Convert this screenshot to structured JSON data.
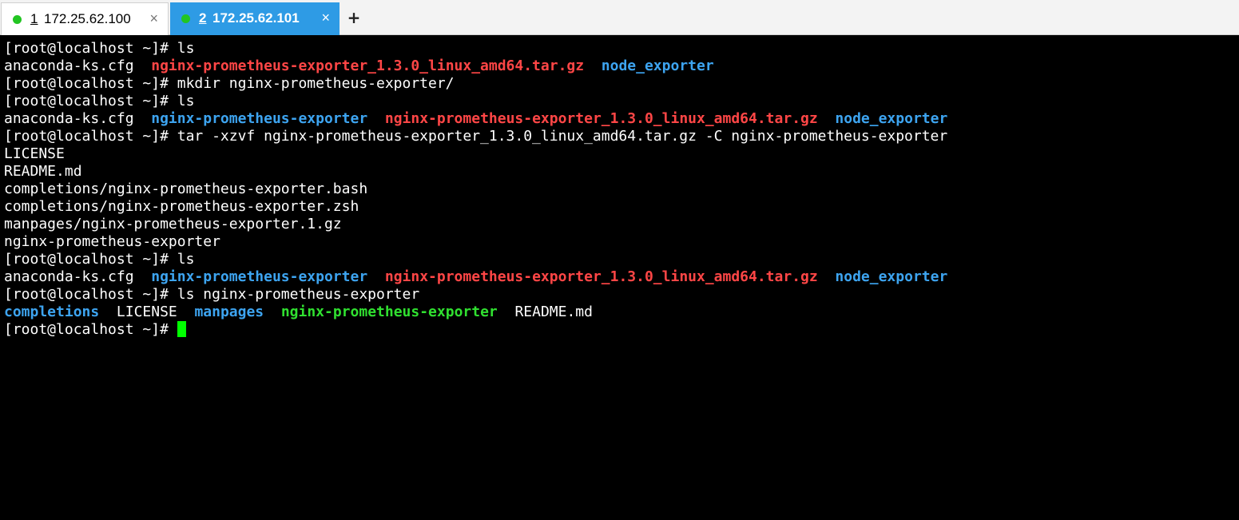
{
  "tabs": [
    {
      "number": "1",
      "host": "172.25.62.100",
      "close": "×",
      "status_color": "#22c522",
      "active": false
    },
    {
      "number": "2",
      "host": "172.25.62.101",
      "close": "×",
      "status_color": "#22c522",
      "active": true
    }
  ],
  "add_tab_label": "+",
  "colors": {
    "accent_tab": "#2e9be5",
    "directory": "#3da4f0",
    "archive": "#ff4646",
    "executable": "#30e030",
    "cursor": "#00ff00",
    "background": "#000000"
  },
  "terminal": {
    "lines": [
      [
        {
          "text": "[root@localhost ~]# ls",
          "style": "default"
        }
      ],
      [
        {
          "text": "anaconda-ks.cfg  ",
          "style": "default"
        },
        {
          "text": "nginx-prometheus-exporter_1.3.0_linux_amd64.tar.gz",
          "style": "red"
        },
        {
          "text": "  ",
          "style": "default"
        },
        {
          "text": "node_exporter",
          "style": "blue"
        }
      ],
      [
        {
          "text": "[root@localhost ~]# mkdir nginx-prometheus-exporter/",
          "style": "default"
        }
      ],
      [
        {
          "text": "[root@localhost ~]# ls",
          "style": "default"
        }
      ],
      [
        {
          "text": "anaconda-ks.cfg  ",
          "style": "default"
        },
        {
          "text": "nginx-prometheus-exporter",
          "style": "blue"
        },
        {
          "text": "  ",
          "style": "default"
        },
        {
          "text": "nginx-prometheus-exporter_1.3.0_linux_amd64.tar.gz",
          "style": "red"
        },
        {
          "text": "  ",
          "style": "default"
        },
        {
          "text": "node_exporter",
          "style": "blue"
        }
      ],
      [
        {
          "text": "[root@localhost ~]# tar -xzvf nginx-prometheus-exporter_1.3.0_linux_amd64.tar.gz -C nginx-prometheus-exporter",
          "style": "default"
        }
      ],
      [
        {
          "text": "LICENSE",
          "style": "default"
        }
      ],
      [
        {
          "text": "README.md",
          "style": "default"
        }
      ],
      [
        {
          "text": "completions/nginx-prometheus-exporter.bash",
          "style": "default"
        }
      ],
      [
        {
          "text": "completions/nginx-prometheus-exporter.zsh",
          "style": "default"
        }
      ],
      [
        {
          "text": "manpages/nginx-prometheus-exporter.1.gz",
          "style": "default"
        }
      ],
      [
        {
          "text": "nginx-prometheus-exporter",
          "style": "default"
        }
      ],
      [
        {
          "text": "[root@localhost ~]# ls",
          "style": "default"
        }
      ],
      [
        {
          "text": "anaconda-ks.cfg  ",
          "style": "default"
        },
        {
          "text": "nginx-prometheus-exporter",
          "style": "blue"
        },
        {
          "text": "  ",
          "style": "default"
        },
        {
          "text": "nginx-prometheus-exporter_1.3.0_linux_amd64.tar.gz",
          "style": "red"
        },
        {
          "text": "  ",
          "style": "default"
        },
        {
          "text": "node_exporter",
          "style": "blue"
        }
      ],
      [
        {
          "text": "[root@localhost ~]# ls nginx-prometheus-exporter",
          "style": "default"
        }
      ],
      [
        {
          "text": "completions",
          "style": "blue"
        },
        {
          "text": "  LICENSE  ",
          "style": "default"
        },
        {
          "text": "manpages",
          "style": "blue"
        },
        {
          "text": "  ",
          "style": "default"
        },
        {
          "text": "nginx-prometheus-exporter",
          "style": "green"
        },
        {
          "text": "  README.md",
          "style": "default"
        }
      ],
      [
        {
          "text": "[root@localhost ~]# ",
          "style": "default"
        }
      ]
    ],
    "prompt_cursor": true
  }
}
